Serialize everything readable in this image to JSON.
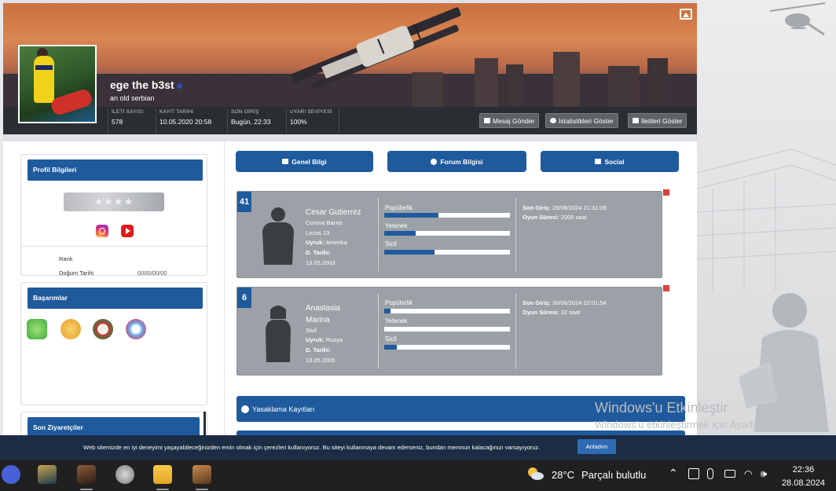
{
  "profile": {
    "username": "ege the b3st",
    "subtitle": "an old serbian",
    "stats": [
      {
        "label": "İLETİ SAYISI",
        "value": "578"
      },
      {
        "label": "KAYIT TARİHİ",
        "value": "10.05.2020 20:58"
      },
      {
        "label": "SON GİRİŞ",
        "value": "Bugün, 22:33"
      },
      {
        "label": "UYARI SEVİYESİ",
        "value": "100%"
      }
    ],
    "buttons": [
      "Mesaj Gönder",
      "İstatistikleri Göster",
      "İletileri Göster"
    ]
  },
  "sidebar": {
    "profile_title": "Profil Bilgileri",
    "rank_label": "Rank",
    "birth_label": "Doğum Tarihi",
    "birth_value": "0000/00/00",
    "stars": "★★★★",
    "achievements_title": "Başarımlar",
    "visitors_title": "Son Ziyaretçiler"
  },
  "tabs": [
    "Genel Bilgi",
    "Forum Bilgisi",
    "Social"
  ],
  "characters": [
    {
      "id": "41",
      "name": "Cesar Gutierrez",
      "faction": "Corona Barrio",
      "rank": "Locos 13",
      "nationality_label": "Uyruk:",
      "nationality": "Amerika",
      "birth_label": "D. Tarihi:",
      "birth": "13.05.2003",
      "gender": "male",
      "bars": [
        {
          "label": "Popülerlik",
          "value": 0.43
        },
        {
          "label": "Yetenek",
          "value": 0.25
        },
        {
          "label": "Sicil",
          "value": 0.4
        }
      ],
      "last_login_label": "Son Giriş:",
      "last_login": "28/08/2024 21:31:09",
      "play_label": "Oyun Süresi:",
      "play_time": "2000 saat"
    },
    {
      "id": "6",
      "name_line1": "Anastasia",
      "name_line2": "Marina",
      "faction": "Sivil",
      "nationality_label": "Uyruk:",
      "nationality": "Rusya",
      "birth_label": "D. Tarihi:",
      "birth": "13.05.2005",
      "gender": "female",
      "bars": [
        {
          "label": "Popülerlik",
          "value": 0.05
        },
        {
          "label": "Yetenek",
          "value": 0.0
        },
        {
          "label": "Sicil",
          "value": 0.1
        }
      ],
      "last_login_label": "Son Giriş:",
      "last_login": "30/06/2024 22:01:54",
      "play_label": "Oyun Süresi:",
      "play_time": "32 saat"
    }
  ],
  "sections": [
    "Yasaklama Kayıtları"
  ],
  "watermark": {
    "title": "Windows'u Etkinleştir",
    "subtitle": "Windows'u etkinleştirmek için Ayarlar'a gidin."
  },
  "cookie": {
    "text": "Web sitemizde en iyi deneyimi yaşayabileceğinizden emin olmak için çerezleri kullanıyoruz. Bu siteyi kullanmaya devam ederseniz, bundan memnun kalacağınızı varsayıyoruz.",
    "button": "Anladım"
  },
  "taskbar": {
    "weather_temp": "28°C",
    "weather_desc": "Parçalı bulutlu",
    "time": "22:36",
    "date": "28.08.2024"
  },
  "colors": {
    "accent": "#1f5a9c",
    "card_gray": "#9ca1a7",
    "danger": "#d9423a",
    "statbar": "#2a2d31"
  }
}
